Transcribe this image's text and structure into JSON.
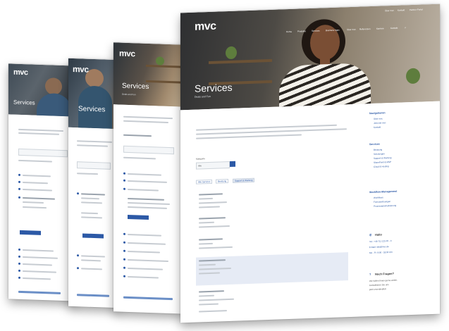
{
  "brand": {
    "logo_text": "mvc"
  },
  "page": {
    "title": "Services",
    "subtitle": "Deals and Fun"
  },
  "top_nav": {
    "links": [
      "Über mvc",
      "Kontakt",
      "Partner-Portal"
    ]
  },
  "main_nav": {
    "items": [
      "Home",
      "Produkte",
      "Services",
      "Business Apps",
      "Über mvc",
      "Referenzen",
      "Karriere",
      "Kontakt"
    ]
  },
  "sidebar": {
    "sections": [
      {
        "title": "Navigationen",
        "items": [
          "Über mvc",
          "Jobs bei mvc",
          "Kontakt"
        ]
      },
      {
        "title": "Services",
        "items": [
          "Beratung",
          "Schulungen",
          "Support & Wartung",
          "SharePoint & MSP",
          "Cloud & Hosting"
        ]
      },
      {
        "title": "Workflow-Management",
        "items": [
          "Workflows",
          "Formularlösungen",
          "Prozessautomatisierung"
        ]
      }
    ]
  },
  "contact": {
    "heading": "Hallo",
    "lines": [
      "Tel.: +49 711 123 45 - 0",
      "E-Mail: info@mvc.de",
      "Mo - Fr: 9:00 - 18:00 Uhr"
    ]
  },
  "faq": {
    "heading": "Noch Fragen?",
    "lines": [
      "Wir helfen Ihnen gerne weiter.",
      "Kontaktieren Sie uns",
      "jetzt unverbindlich"
    ]
  },
  "tabs": [
    "Alle Services",
    "Beratung",
    "Support & Wartung"
  ],
  "filter": {
    "label": "Kategorie",
    "placeholder": "Alle"
  }
}
